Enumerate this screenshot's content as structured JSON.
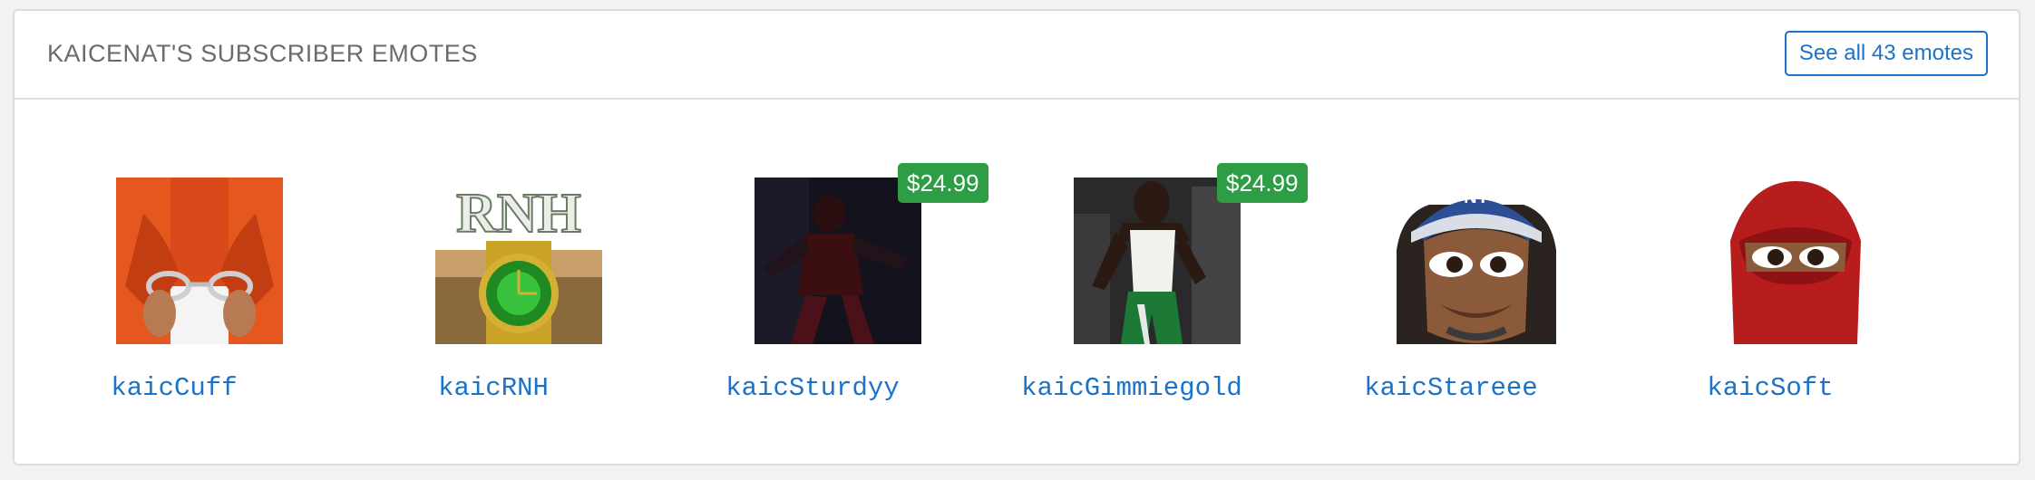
{
  "header": {
    "title": "KAICENAT'S SUBSCRIBER EMOTES",
    "see_all_label": "See all 43 emotes"
  },
  "emotes": [
    {
      "name": "kaicCuff",
      "price": null,
      "icon": "handcuffs-emote"
    },
    {
      "name": "kaicRNH",
      "price": null,
      "icon": "gold-watch-emote"
    },
    {
      "name": "kaicSturdyy",
      "price": "$24.99",
      "icon": "dancing-figure-emote"
    },
    {
      "name": "kaicGimmiegold",
      "price": "$24.99",
      "icon": "dancing-man-emote"
    },
    {
      "name": "kaicStareee",
      "price": null,
      "icon": "staring-face-emote"
    },
    {
      "name": "kaicSoft",
      "price": null,
      "icon": "red-mask-emote"
    }
  ],
  "colors": {
    "accent": "#1a73c8",
    "price_badge": "#2e9e46",
    "title_text": "#6b6b6b"
  }
}
